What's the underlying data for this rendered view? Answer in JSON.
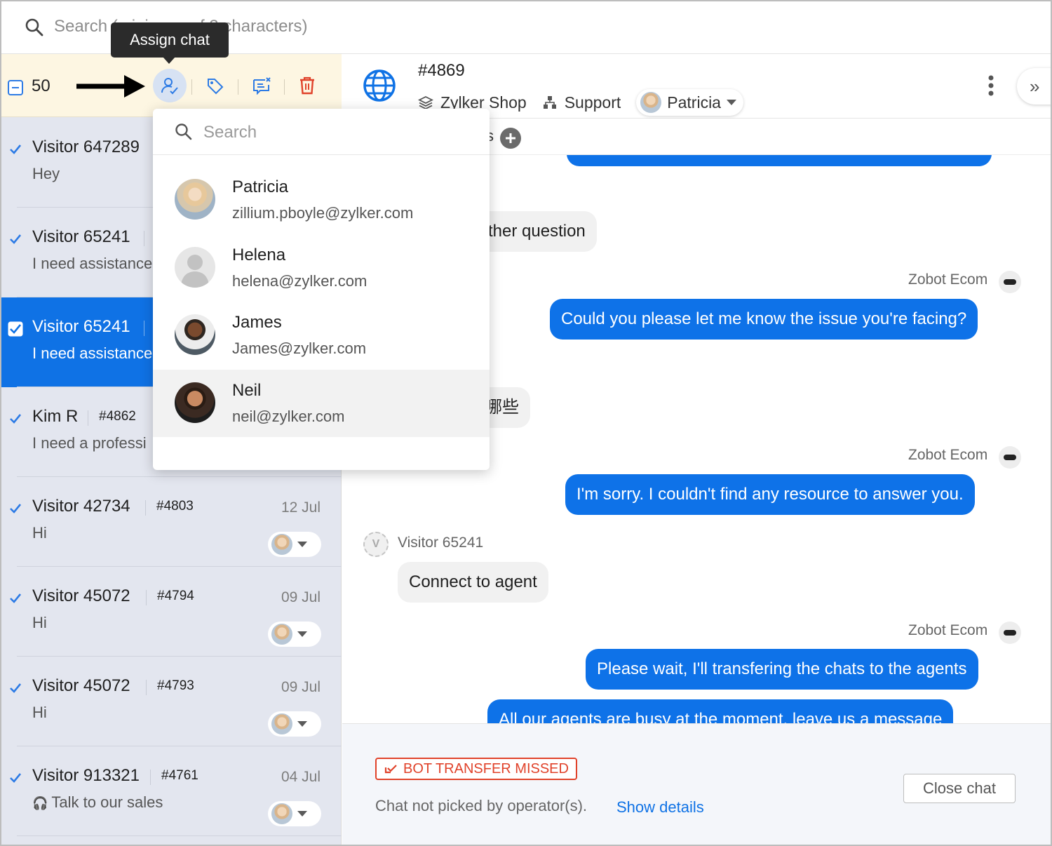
{
  "search": {
    "placeholder": "Search (minimum of 3 characters)"
  },
  "tooltip": {
    "label": "Assign chat"
  },
  "toolbar": {
    "selected_count": "50"
  },
  "chats": [
    {
      "name": "Visitor 647289",
      "id": "",
      "message": "Hey",
      "date": "",
      "selected": false
    },
    {
      "name": "Visitor 65241",
      "id": "",
      "message": "I need assistance",
      "date": "",
      "selected": false
    },
    {
      "name": "Visitor 65241",
      "id": "",
      "message": "I need assistance",
      "date": "",
      "selected": true
    },
    {
      "name": "Kim R",
      "id": "#4862",
      "message": "I need a professi",
      "date": "",
      "selected": false
    },
    {
      "name": "Visitor 42734",
      "id": "#4803",
      "message": "Hi",
      "date": "12 Jul",
      "selected": false
    },
    {
      "name": "Visitor 45072",
      "id": "#4794",
      "message": "Hi",
      "date": "09 Jul",
      "selected": false
    },
    {
      "name": "Visitor 45072",
      "id": "#4793",
      "message": "Hi",
      "date": "09 Jul",
      "selected": false
    },
    {
      "name": "Visitor 913321",
      "id": "#4761",
      "message": "Talk to our sales",
      "date": "04 Jul",
      "selected": false
    }
  ],
  "header": {
    "chat_id": "#4869",
    "brand": "Zylker Shop",
    "department": "Support",
    "agent": "Patricia"
  },
  "subbar": {
    "fragment": "s"
  },
  "messages": [
    {
      "type": "user",
      "text": "ther question"
    },
    {
      "type": "bot",
      "sender": "Zobot Ecom",
      "text": "Could you please let me know the issue you're facing?"
    },
    {
      "type": "user",
      "text": "哪些"
    },
    {
      "type": "bot",
      "sender": "Zobot Ecom",
      "text": "I'm sorry. I couldn't find any resource to answer you."
    },
    {
      "type": "user",
      "sender": "Visitor 65241",
      "text": "Connect to agent"
    },
    {
      "type": "bot",
      "sender": "Zobot Ecom",
      "text": "Please wait, I'll transfering the chats to the agents"
    },
    {
      "type": "bot",
      "text": "All our agents are busy at the moment, leave us a message"
    }
  ],
  "status": {
    "badge": "BOT TRANSFER MISSED",
    "note": "Chat not picked by operator(s).",
    "link": "Show details",
    "close_button": "Close chat"
  },
  "assign_dropdown": {
    "search_placeholder": "Search",
    "agents": [
      {
        "name": "Patricia",
        "email": "zillium.pboyle@zylker.com"
      },
      {
        "name": "Helena",
        "email": "helena@zylker.com"
      },
      {
        "name": "James",
        "email": "James@zylker.com"
      },
      {
        "name": "Neil",
        "email": "neil@zylker.com"
      }
    ]
  },
  "colors": {
    "accent": "#0f72e5",
    "selected_bg": "#0f72e5",
    "toolbar_bg": "#fdf6e2",
    "missed": "#e0422a"
  }
}
